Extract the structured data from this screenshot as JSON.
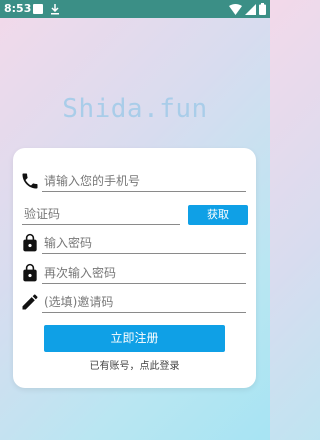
{
  "status_bar": {
    "time": "8:53",
    "icons": [
      "app-square-icon",
      "download-icon",
      "wifi-icon",
      "signal-icon",
      "battery-icon"
    ]
  },
  "brand": {
    "title": "Shida.fun"
  },
  "form": {
    "phone": {
      "placeholder": "请输入您的手机号",
      "value": "",
      "icon": "phone-icon"
    },
    "verification_code": {
      "placeholder": "验证码",
      "value": ""
    },
    "get_code_label": "获取",
    "password": {
      "placeholder": "输入密码",
      "value": "",
      "icon": "lock-icon"
    },
    "confirm_password": {
      "placeholder": "再次输入密码",
      "value": "",
      "icon": "lock-icon"
    },
    "invite_code": {
      "placeholder": "(选填)邀请码",
      "value": "",
      "icon": "pencil-icon"
    },
    "register_label": "立即注册",
    "login_link": "已有账号，点此登录"
  },
  "colors": {
    "status_bar": "#3b8f86",
    "accent": "#0fa0e6",
    "brand_text": "#a9cde9",
    "card": "#ffffff"
  }
}
